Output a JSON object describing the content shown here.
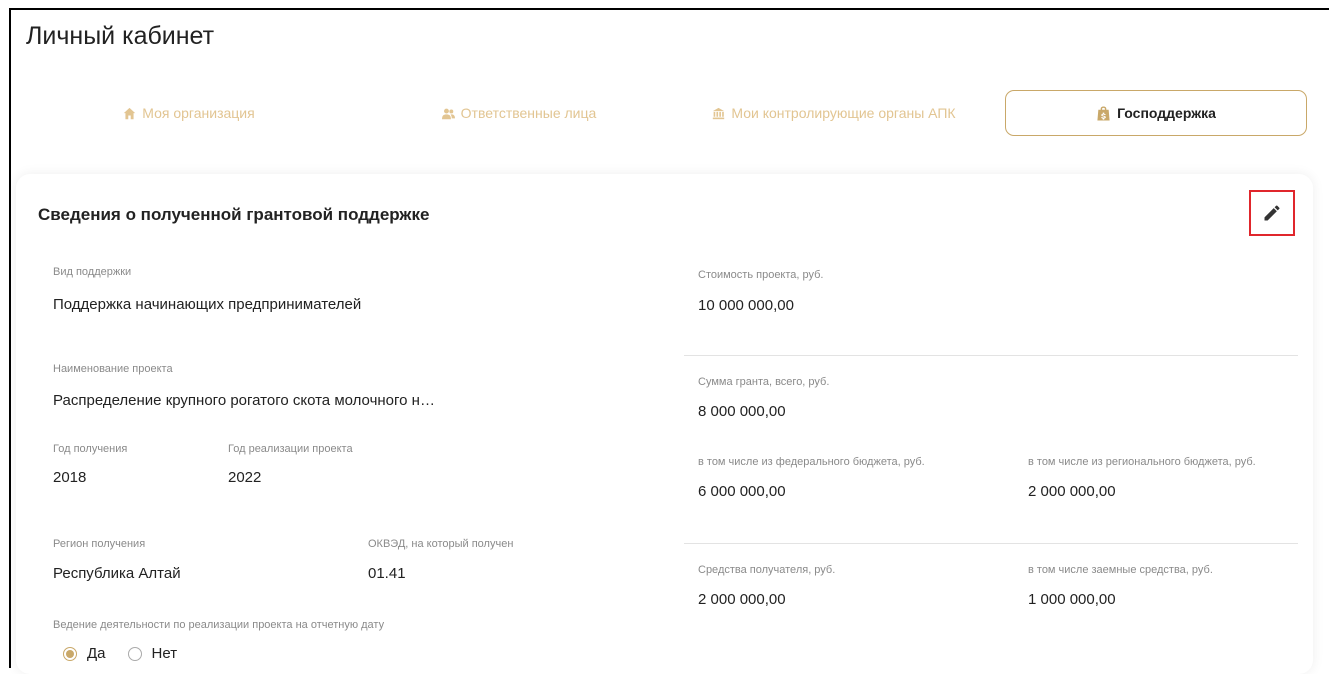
{
  "header": {
    "title": "Личный кабинет"
  },
  "tabs": [
    {
      "label": "Моя организация",
      "icon": "home-icon",
      "active": false
    },
    {
      "label": "Ответственные лица",
      "icon": "users-icon",
      "active": false
    },
    {
      "label": "Мои контролирующие органы АПК",
      "icon": "institution-icon",
      "active": false
    },
    {
      "label": "Господдержка",
      "icon": "bag-icon",
      "active": true
    }
  ],
  "colors": {
    "accent": "#c9a869",
    "accent_light": "#e2c592",
    "highlight": "#e0262c"
  },
  "card": {
    "title": "Сведения о полученной грантовой поддержке",
    "edit_icon": "pencil-icon",
    "left": {
      "support_type": {
        "label": "Вид  поддержки",
        "value": "Поддержка начинающих предпринимателей"
      },
      "project_name": {
        "label": "Наименование проекта",
        "value": "Распределение крупного рогатого скота молочного н…"
      },
      "year_received": {
        "label": "Год получения",
        "value": "2018"
      },
      "year_implementation": {
        "label": "Год реализации проекта",
        "value": "2022"
      },
      "region": {
        "label": "Регион получения",
        "value": "Республика Алтай"
      },
      "okved": {
        "label": "ОКВЭД, на который получен",
        "value": "01.41"
      },
      "activity": {
        "label": "Ведение деятельности по реализации проекта на отчетную дату",
        "options": [
          "Да",
          "Нет"
        ],
        "selected": "Да"
      }
    },
    "right": {
      "project_cost": {
        "label": "Стоимость проекта, руб.",
        "value": "10 000 000,00"
      },
      "grant_total": {
        "label": "Сумма гранта, всего, руб.",
        "value": "8 000 000,00"
      },
      "federal": {
        "label": "в том числе из федерального бюджета, руб.",
        "value": "6 000 000,00"
      },
      "regional": {
        "label": "в том числе из регионального бюджета, руб.",
        "value": "2 000 000,00"
      },
      "recipient_funds": {
        "label": "Средства получателя, руб.",
        "value": "2 000 000,00"
      },
      "borrowed": {
        "label": "в том числе заемные средства, руб.",
        "value": "1 000 000,00"
      }
    }
  }
}
